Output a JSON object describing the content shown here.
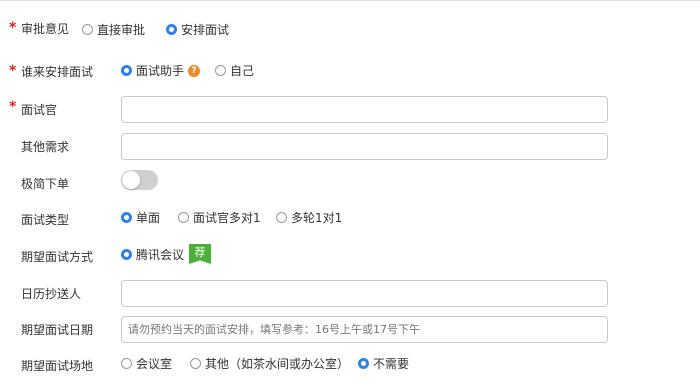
{
  "approval": {
    "label": "审批意见",
    "options": [
      {
        "label": "直接审批",
        "selected": false
      },
      {
        "label": "安排面试",
        "selected": true
      }
    ]
  },
  "arranger": {
    "label": "谁来安排面试",
    "options": [
      {
        "label": "面试助手",
        "selected": true
      },
      {
        "label": "自己",
        "selected": false
      }
    ],
    "help_icon_text": "?"
  },
  "interviewer": {
    "label": "面试官",
    "value": ""
  },
  "other_needs": {
    "label": "其他需求",
    "value": ""
  },
  "simple_order": {
    "label": "极简下单",
    "on": false
  },
  "interview_type": {
    "label": "面试类型",
    "options": [
      {
        "label": "单面",
        "selected": true
      },
      {
        "label": "面试官多对1",
        "selected": false
      },
      {
        "label": "多轮1对1",
        "selected": false
      }
    ]
  },
  "interview_method": {
    "label": "期望面试方式",
    "options": [
      {
        "label": "腾讯会议",
        "selected": true
      }
    ],
    "badge": "荐"
  },
  "calendar_cc": {
    "label": "日历抄送人",
    "value": ""
  },
  "interview_date": {
    "label": "期望面试日期",
    "placeholder": "请勿预约当天的面试安排，填写参考：16号上午或17号下午"
  },
  "interview_location": {
    "label": "期望面试场地",
    "options": [
      {
        "label": "会议室",
        "selected": false
      },
      {
        "label": "其他（如茶水间或办公室）",
        "selected": false
      },
      {
        "label": "不需要",
        "selected": true
      }
    ]
  },
  "colors": {
    "accent": "#2f80ed",
    "required_star": "#d9241c",
    "help_icon": "#f08a24",
    "badge": "#4caf3a"
  }
}
